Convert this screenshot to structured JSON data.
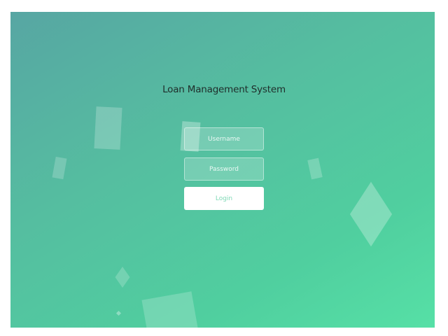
{
  "app": {
    "title": "Loan Management System"
  },
  "login_form": {
    "username_placeholder": "Username",
    "username_value": "",
    "password_placeholder": "Password",
    "password_value": "",
    "login_label": "Login"
  },
  "colors": {
    "background_gradient_start": "#57a6a3",
    "background_gradient_end": "#56e0a6",
    "title_text": "#1f2d2a",
    "button_background": "#ffffff",
    "button_text": "#7fd9b6"
  }
}
